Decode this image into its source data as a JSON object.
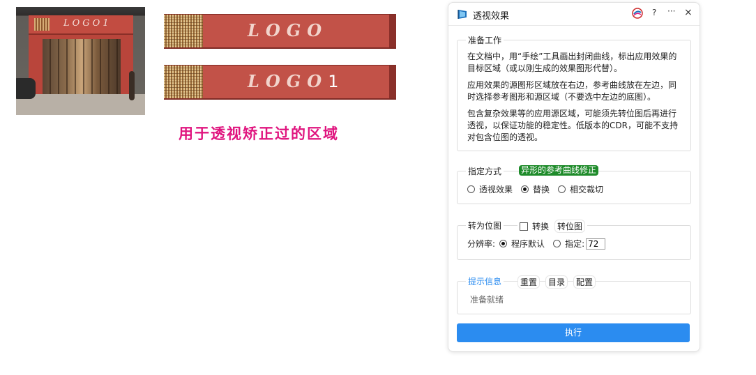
{
  "canvas": {
    "storefront_sign": "LOGO1",
    "banner1_logo": "LOGO",
    "banner2_logo": "LOGO",
    "banner2_suffix": "1",
    "caption": "用于透视矫正过的区域"
  },
  "panel": {
    "title": "透视效果",
    "help_label": "?",
    "more_label": "···",
    "close_label": "×",
    "prep": {
      "legend": "准备工作",
      "p1": "在文档中，用“手绘”工具画出封闭曲线，标出应用效果的目标区域（或以刚生成的效果图形代替）。",
      "p2": "应用效果的源图形区域放在右边，参考曲线放在左边，同时选择参考图形和源区域（不要选中左边的底图）。",
      "p3": "包含复杂效果等的应用源区域，可能须先转位图后再进行透视，以保证功能的稳定性。低版本的CDR，可能不支持对包含位图的透视。"
    },
    "mode": {
      "legend": "指定方式",
      "badge": "异形的参考曲线修正",
      "options": [
        "透视效果",
        "替换",
        "相交裁切"
      ],
      "selected": "替换"
    },
    "bitmap": {
      "legend": "转为位图",
      "convert_label": "转换",
      "convert_button": "转位图",
      "resolution_label": "分辨率:",
      "default_option": "程序默认",
      "specify_option": "指定:",
      "specify_value": "72"
    },
    "info": {
      "legend": "提示信息",
      "reset_button": "重置",
      "catalog_button": "目录",
      "config_button": "配置",
      "status": "准备就绪"
    },
    "execute_button": "执行"
  },
  "colors": {
    "accent": "#2b8cf0",
    "badge_green": "#1e8b2a",
    "caption_magenta": "#e0157f",
    "info_legend_blue": "#2b8cf0"
  }
}
